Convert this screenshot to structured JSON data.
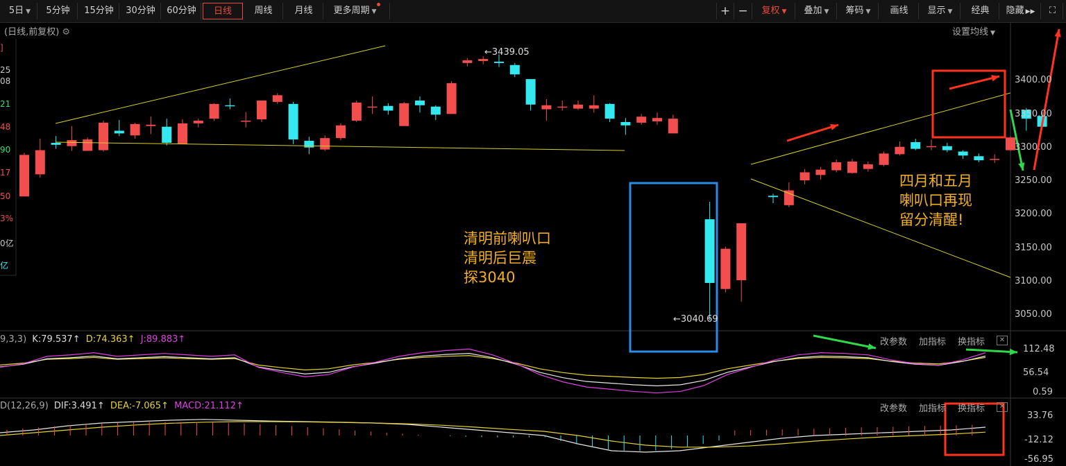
{
  "toolbar": {
    "periods": [
      "5日",
      "5分钟",
      "15分钟",
      "30分钟",
      "60分钟",
      "日线",
      "周线",
      "月线",
      "更多周期"
    ],
    "active_period": "日线",
    "right": {
      "plus": "+",
      "minus": "−",
      "fuquan": "复权",
      "overlay": "叠加",
      "chips": "筹码",
      "draw": "画线",
      "display": "显示",
      "classic": "经典",
      "hide": "隐藏",
      "hide_arrows": "▶▶",
      "fullscreen": "⛶"
    }
  },
  "chart_header": {
    "title": "(日线,前复权)",
    "ma_setting": "设置均线"
  },
  "left_clipped": [
    "]",
    "25",
    "08",
    "21",
    "48",
    "90",
    "17",
    "50",
    "3%",
    "0亿",
    "亿"
  ],
  "price_axis": {
    "ticks": [
      "3400.00",
      "3350.00",
      "3300.00",
      "3250.00",
      "3200.00",
      "3150.00",
      "3100.00",
      "3050.00"
    ]
  },
  "annotations": {
    "high_marker": "3439.05",
    "low_marker": "3040.69",
    "note_left": [
      "清明前喇叭口",
      "清明后巨震",
      "探3040"
    ],
    "note_right": [
      "四月和五月",
      "喇叭口再现",
      "留分清醒!"
    ]
  },
  "kdj": {
    "prefix": "9,3,3)",
    "k": "K:79.537",
    "d": "D:74.363",
    "j": "J:89.883",
    "axis": [
      "112.48",
      "56.54",
      "0.59"
    ],
    "buttons": [
      "改参数",
      "加指标",
      "换指标"
    ]
  },
  "macd": {
    "prefix": "D(12,26,9)",
    "dif": "DIF:3.491",
    "dea": "DEA:-7.065",
    "macd": "MACD:21.112",
    "axis": [
      "33.76",
      "-12.12",
      "-56.95"
    ],
    "buttons": [
      "改参数",
      "加指标",
      "换指标"
    ]
  },
  "colors": {
    "up": "#f24e4e",
    "down": "#34e8f0",
    "accent": "#e84a3c",
    "yellow_line": "#d8d02a",
    "box_blue": "#2a8ce6",
    "box_red": "#ff3320",
    "annotation": "#f2b01e"
  },
  "chart_data": {
    "type": "candlestick",
    "ylabel": "",
    "ylim": [
      3035,
      3470
    ],
    "candles": [
      {
        "o": 3227,
        "c": 3289,
        "h": 3292,
        "l": 3227
      },
      {
        "o": 3260,
        "c": 3296,
        "h": 3313,
        "l": 3255
      },
      {
        "o": 3307,
        "c": 3304,
        "h": 3317,
        "l": 3298
      },
      {
        "o": 3302,
        "c": 3311,
        "h": 3332,
        "l": 3295
      },
      {
        "o": 3295,
        "c": 3312,
        "h": 3315,
        "l": 3295
      },
      {
        "o": 3296,
        "c": 3337,
        "h": 3340,
        "l": 3294
      },
      {
        "o": 3325,
        "c": 3321,
        "h": 3341,
        "l": 3317
      },
      {
        "o": 3318,
        "c": 3335,
        "h": 3337,
        "l": 3313
      },
      {
        "o": 3332,
        "c": 3334,
        "h": 3346,
        "l": 3320
      },
      {
        "o": 3331,
        "c": 3307,
        "h": 3343,
        "l": 3303
      },
      {
        "o": 3305,
        "c": 3336,
        "h": 3342,
        "l": 3305
      },
      {
        "o": 3336,
        "c": 3340,
        "h": 3343,
        "l": 3330
      },
      {
        "o": 3343,
        "c": 3365,
        "h": 3366,
        "l": 3340
      },
      {
        "o": 3363,
        "c": 3362,
        "h": 3373,
        "l": 3357
      },
      {
        "o": 3339,
        "c": 3340,
        "h": 3353,
        "l": 3330
      },
      {
        "o": 3342,
        "c": 3370,
        "h": 3370,
        "l": 3338
      },
      {
        "o": 3368,
        "c": 3378,
        "h": 3381,
        "l": 3365
      },
      {
        "o": 3365,
        "c": 3312,
        "h": 3368,
        "l": 3305
      },
      {
        "o": 3310,
        "c": 3300,
        "h": 3316,
        "l": 3290
      },
      {
        "o": 3297,
        "c": 3314,
        "h": 3318,
        "l": 3295
      },
      {
        "o": 3314,
        "c": 3333,
        "h": 3336,
        "l": 3311
      },
      {
        "o": 3340,
        "c": 3367,
        "h": 3370,
        "l": 3338
      },
      {
        "o": 3361,
        "c": 3361,
        "h": 3376,
        "l": 3350
      },
      {
        "o": 3362,
        "c": 3355,
        "h": 3366,
        "l": 3349
      },
      {
        "o": 3332,
        "c": 3366,
        "h": 3368,
        "l": 3332
      },
      {
        "o": 3370,
        "c": 3363,
        "h": 3376,
        "l": 3352
      },
      {
        "o": 3361,
        "c": 3349,
        "h": 3363,
        "l": 3341
      },
      {
        "o": 3350,
        "c": 3396,
        "h": 3399,
        "l": 3350
      },
      {
        "o": 3426,
        "c": 3430,
        "h": 3433,
        "l": 3421
      },
      {
        "o": 3429,
        "c": 3432,
        "h": 3436,
        "l": 3424
      },
      {
        "o": 3428,
        "c": 3426,
        "h": 3439,
        "l": 3420
      },
      {
        "o": 3423,
        "c": 3409,
        "h": 3426,
        "l": 3405
      },
      {
        "o": 3402,
        "c": 3364,
        "h": 3402,
        "l": 3355
      },
      {
        "o": 3357,
        "c": 3363,
        "h": 3372,
        "l": 3340
      },
      {
        "o": 3360,
        "c": 3361,
        "h": 3370,
        "l": 3355
      },
      {
        "o": 3358,
        "c": 3364,
        "h": 3370,
        "l": 3356
      },
      {
        "o": 3358,
        "c": 3363,
        "h": 3378,
        "l": 3352
      },
      {
        "o": 3365,
        "c": 3343,
        "h": 3366,
        "l": 3338
      },
      {
        "o": 3338,
        "c": 3333,
        "h": 3344,
        "l": 3319
      },
      {
        "o": 3337,
        "c": 3346,
        "h": 3350,
        "l": 3334
      },
      {
        "o": 3339,
        "c": 3344,
        "h": 3352,
        "l": 3334
      },
      {
        "o": 3321,
        "c": 3343,
        "h": 3349,
        "l": 3321
      },
      {
        "o": 3193,
        "c": 3098,
        "h": 3219,
        "l": 3042
      },
      {
        "o": 3089,
        "c": 3149,
        "h": 3152,
        "l": 3084
      },
      {
        "o": 3102,
        "c": 3187,
        "h": 3187,
        "l": 3070
      },
      {
        "o": 3228,
        "c": 3226,
        "h": 3231,
        "l": 3217
      },
      {
        "o": 3214,
        "c": 3236,
        "h": 3248,
        "l": 3211
      },
      {
        "o": 3251,
        "c": 3263,
        "h": 3268,
        "l": 3245
      },
      {
        "o": 3259,
        "c": 3267,
        "h": 3271,
        "l": 3252
      },
      {
        "o": 3266,
        "c": 3278,
        "h": 3282,
        "l": 3263
      },
      {
        "o": 3262,
        "c": 3279,
        "h": 3283,
        "l": 3261
      },
      {
        "o": 3268,
        "c": 3275,
        "h": 3279,
        "l": 3264
      },
      {
        "o": 3274,
        "c": 3291,
        "h": 3294,
        "l": 3272
      },
      {
        "o": 3290,
        "c": 3301,
        "h": 3309,
        "l": 3288
      },
      {
        "o": 3308,
        "c": 3298,
        "h": 3313,
        "l": 3296
      },
      {
        "o": 3301,
        "c": 3302,
        "h": 3312,
        "l": 3296
      },
      {
        "o": 3302,
        "c": 3296,
        "h": 3307,
        "l": 3293
      },
      {
        "o": 3294,
        "c": 3288,
        "h": 3296,
        "l": 3283
      },
      {
        "o": 3287,
        "c": 3281,
        "h": 3291,
        "l": 3278
      },
      {
        "o": 3283,
        "c": 3283,
        "h": 3290,
        "l": 3277
      },
      {
        "o": 3296,
        "c": 3315,
        "h": 3317,
        "l": 3295
      },
      {
        "o": 3356,
        "c": 3343,
        "h": 3359,
        "l": 3325
      },
      {
        "o": 3347,
        "c": 3331,
        "h": 3353,
        "l": 3328
      }
    ]
  }
}
